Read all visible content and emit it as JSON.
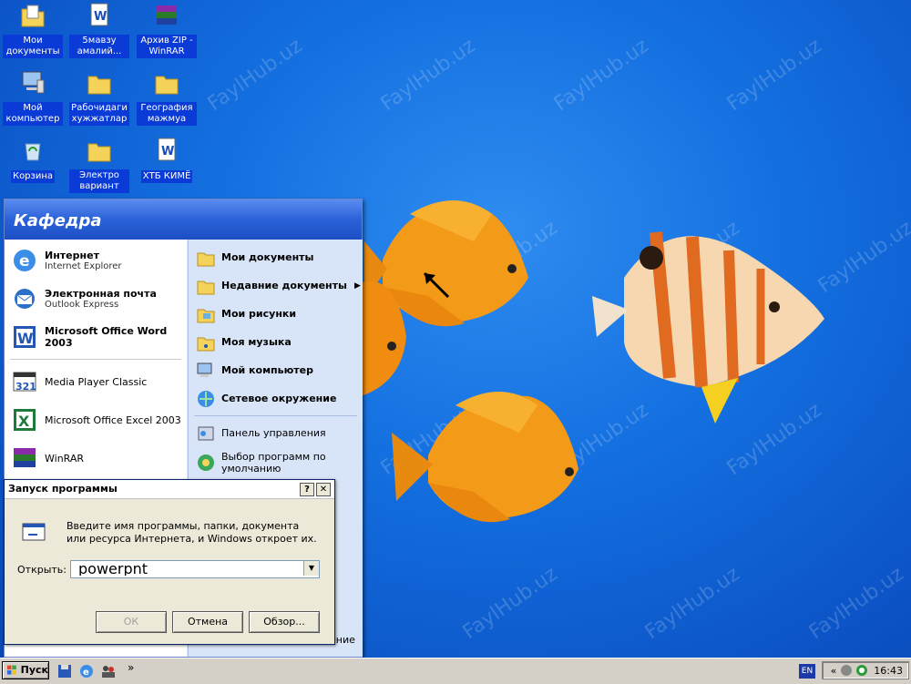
{
  "desktop": {
    "watermark": "FaylHub.uz",
    "icons": [
      {
        "label": "Мои документы",
        "icon": "my-documents-folder-icon"
      },
      {
        "label": "5мавзу амалий...",
        "icon": "word-document-icon"
      },
      {
        "label": "Архив ZIP - WinRAR",
        "icon": "winrar-archive-icon"
      },
      {
        "label": "Мой компьютер",
        "icon": "my-computer-icon"
      },
      {
        "label": "Рабочидаги хужжатлар",
        "icon": "folder-icon"
      },
      {
        "label": "География мажмуа",
        "icon": "folder-icon"
      },
      {
        "label": "Корзина",
        "icon": "recycle-bin-icon"
      },
      {
        "label": "Электро вариант",
        "icon": "folder-icon"
      },
      {
        "label": "ХТБ КИМЁ",
        "icon": "word-document-icon"
      }
    ]
  },
  "start_menu": {
    "user": "Кафедра",
    "left_items": [
      {
        "title": "Интернет",
        "subtitle": "Internet Explorer",
        "icon": "internet-explorer-icon"
      },
      {
        "title": "Электронная почта",
        "subtitle": "Outlook Express",
        "icon": "outlook-express-icon"
      },
      {
        "title": "Microsoft Office Word 2003",
        "subtitle": "",
        "icon": "word-icon"
      },
      {
        "title": "Media Player Classic",
        "subtitle": "",
        "icon": "media-player-classic-icon"
      },
      {
        "title": "Microsoft Office Excel 2003",
        "subtitle": "",
        "icon": "excel-icon"
      },
      {
        "title": "WinRAR",
        "subtitle": "",
        "icon": "winrar-icon"
      }
    ],
    "right_items": [
      {
        "label": "Мои документы",
        "icon": "my-documents-icon"
      },
      {
        "label": "Недавние документы",
        "icon": "recent-documents-icon",
        "arrow": "▶"
      },
      {
        "label": "Мои рисунки",
        "icon": "my-pictures-icon"
      },
      {
        "label": "Моя музыка",
        "icon": "my-music-icon"
      },
      {
        "label": "Мой компьютер",
        "icon": "my-computer-icon"
      },
      {
        "label": "Сетевое окружение",
        "icon": "network-places-icon"
      }
    ],
    "right_items_secondary": [
      {
        "label": "Панель управления",
        "icon": "control-panel-icon"
      },
      {
        "label": "Выбор программ по умолчанию",
        "icon": "default-programs-icon"
      }
    ],
    "bottom_text": "ение"
  },
  "run_dialog": {
    "title": "Запуск программы",
    "help_btn": "?",
    "close_btn": "✕",
    "description": "Введите имя программы, папки, документа или ресурса Интернета, и Windows откроет их.",
    "open_label": "Открыть:",
    "open_value": "powerpnt",
    "ok_label": "ОК",
    "cancel_label": "Отмена",
    "browse_label": "Обзор..."
  },
  "taskbar": {
    "start_label": "Пуск",
    "language": "EN",
    "time": "16:43",
    "quick_launch": [
      "save-icon",
      "internet-explorer-icon",
      "users-icon"
    ],
    "chevron": "»"
  },
  "colors": {
    "desktop_blue": "#1470e0",
    "start_header": "#2b61d8",
    "label_highlight": "#0b3bd6"
  }
}
